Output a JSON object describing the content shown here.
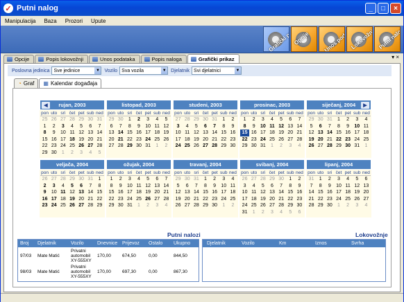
{
  "window": {
    "title": "Putni nalog",
    "minimize": "_",
    "maximize": "□",
    "close": "×"
  },
  "menu": [
    "Manipulacija",
    "Baza",
    "Prozori",
    "Upute"
  ],
  "toolbar": [
    "Grafički prikaz",
    "Opcije",
    "Unos podataka",
    "Lokovožnje",
    "Putni nalog"
  ],
  "tabs": [
    "Opcije",
    "Popis lokovožnji",
    "Unos podataka",
    "Popis naloga",
    "Grafički prikaz"
  ],
  "tab_close": "▾ ×",
  "filters": {
    "jedinica_label": "Poslovna jedinica",
    "jedinica": "Sve jedinice",
    "vozilo_label": "Vozilo",
    "vozilo": "Sva vozila",
    "djelatnik_label": "Djelatnik",
    "djelatnik": "Svi djelatnici",
    "arrow": "▼"
  },
  "subtabs": [
    "Graf",
    "Kalendar događaja"
  ],
  "calendar": {
    "dow": [
      "pon",
      "uto",
      "sri",
      "čet",
      "pet",
      "sub",
      "ned"
    ],
    "nav_prev": "◀",
    "nav_next": "▶",
    "months": [
      {
        "name": "rujan, 2003",
        "days": [
          "25o",
          "26o",
          "27o",
          "28o",
          "29o",
          "30o",
          "31o",
          "1",
          "2",
          "3b",
          "4",
          "5",
          "6",
          "7",
          "8b",
          "9",
          "10",
          "11",
          "12",
          "13",
          "14",
          "15",
          "16",
          "17",
          "18b",
          "19",
          "20",
          "21",
          "22",
          "23",
          "24",
          "25",
          "26b",
          "27b",
          "28",
          "29",
          "30",
          "1o",
          "2o",
          "3o",
          "4o",
          "5o"
        ]
      },
      {
        "name": "listopad, 2003",
        "days": [
          "29o",
          "30o",
          "1",
          "2b",
          "3",
          "4",
          "5",
          "6",
          "7",
          "8",
          "9",
          "10",
          "11",
          "12",
          "13",
          "14b",
          "15",
          "16",
          "17",
          "18",
          "19",
          "20",
          "21b",
          "22",
          "23",
          "24b",
          "25",
          "26",
          "27",
          "28",
          "29b",
          "30",
          "31",
          "1o",
          "2o"
        ]
      },
      {
        "name": "studeni, 2003",
        "days": [
          "27o",
          "28o",
          "29o",
          "30o",
          "31o",
          "1",
          "2",
          "3b",
          "4",
          "5",
          "6b",
          "7b",
          "8",
          "9",
          "10",
          "11",
          "12",
          "13",
          "14",
          "15",
          "16",
          "17",
          "18",
          "19",
          "20",
          "21",
          "22",
          "23",
          "24b",
          "25b",
          "26",
          "27b",
          "28b",
          "29",
          "30"
        ]
      },
      {
        "name": "prosinac, 2003",
        "days": [
          "1",
          "2",
          "3",
          "4",
          "5",
          "6",
          "7",
          "8b",
          "9",
          "10b",
          "11b",
          "12b",
          "13",
          "14",
          "15t",
          "16",
          "17",
          "18",
          "19",
          "20",
          "21",
          "22b",
          "23",
          "24b",
          "25",
          "26",
          "27",
          "28",
          "29",
          "30",
          "31",
          "1o",
          "2o",
          "3o",
          "4o"
        ]
      },
      {
        "name": "siječanj, 2004",
        "days": [
          "29o",
          "30o",
          "31o",
          "1",
          "2",
          "3",
          "4",
          "5",
          "6b",
          "7",
          "8",
          "9",
          "10b",
          "11",
          "12",
          "13b",
          "14b",
          "15",
          "16",
          "17",
          "18",
          "19b",
          "20b",
          "21",
          "22b",
          "23b",
          "24",
          "25",
          "26b",
          "27",
          "28b",
          "29",
          "30b",
          "31",
          "1o"
        ]
      },
      {
        "name": "veljača, 2004",
        "days": [
          "26o",
          "27o",
          "28o",
          "29o",
          "30o",
          "31o",
          "1",
          "2b",
          "3b",
          "4",
          "5b",
          "6b",
          "7",
          "8",
          "9b",
          "10",
          "11b",
          "12",
          "13b",
          "14",
          "15",
          "16b",
          "17b",
          "18",
          "19b",
          "20",
          "21",
          "22",
          "23b",
          "24b",
          "25",
          "26b",
          "27b",
          "28",
          "29"
        ]
      },
      {
        "name": "ožujak, 2004",
        "days": [
          "1",
          "2",
          "3",
          "4",
          "5",
          "6",
          "7",
          "8",
          "9",
          "10",
          "11",
          "12",
          "13",
          "14",
          "15",
          "16",
          "17",
          "18",
          "19",
          "20",
          "21",
          "22",
          "23",
          "24",
          "25",
          "26b",
          "27",
          "28",
          "29",
          "30",
          "31",
          "1o",
          "2o",
          "3o",
          "4o"
        ]
      },
      {
        "name": "travanj, 2004",
        "days": [
          "29o",
          "30o",
          "31o",
          "1",
          "2",
          "3",
          "4",
          "5",
          "6",
          "7",
          "8",
          "9",
          "10",
          "11",
          "12",
          "13",
          "14",
          "15",
          "16",
          "17",
          "18",
          "19",
          "20",
          "21",
          "22",
          "23",
          "24",
          "25",
          "26",
          "27",
          "28",
          "29",
          "30",
          "1o",
          "2o"
        ]
      },
      {
        "name": "svibanj, 2004",
        "days": [
          "26o",
          "27o",
          "28o",
          "29o",
          "30o",
          "1",
          "2",
          "3",
          "4",
          "5",
          "6",
          "7",
          "8",
          "9",
          "10",
          "11",
          "12",
          "13",
          "14",
          "15",
          "16",
          "17",
          "18",
          "19",
          "20",
          "21",
          "22",
          "23",
          "24",
          "25",
          "26",
          "27",
          "28",
          "29",
          "30",
          "31",
          "1o",
          "2o",
          "3o",
          "4o",
          "5o",
          "6o"
        ]
      },
      {
        "name": "lipanj, 2004",
        "days": [
          "31o",
          "1",
          "2",
          "3",
          "4",
          "5",
          "6",
          "7",
          "8",
          "9",
          "10",
          "11",
          "12",
          "13",
          "14",
          "15",
          "16",
          "17",
          "18",
          "19",
          "20",
          "21",
          "22",
          "23",
          "24",
          "25",
          "26",
          "27",
          "28",
          "29",
          "30",
          "1o",
          "2o",
          "3o",
          "4o"
        ]
      }
    ]
  },
  "putni_nalozi": {
    "title": "Putni nalozi",
    "columns": [
      "Broj",
      "Djelatnik",
      "Vozilo",
      "Dnevnice",
      "Prijevoz",
      "Ostalo",
      "Ukupno"
    ],
    "rows": [
      {
        "broj": "97/03",
        "djelatnik": "Mate Matić",
        "vozilo": [
          "Privatni",
          "automobil",
          "XY-555XY"
        ],
        "dnevnice": "170,00",
        "prijevoz": "674,50",
        "ostalo": "0,00",
        "ukupno": "844,50"
      },
      {
        "broj": "98/03",
        "djelatnik": "Mate Matić",
        "vozilo": [
          "Privatni",
          "automobil",
          "XY-555XY"
        ],
        "dnevnice": "170,00",
        "prijevoz": "697,30",
        "ostalo": "0,00",
        "ukupno": "867,30"
      }
    ]
  },
  "lokovoznje": {
    "title": "Lokovožnje",
    "columns": [
      "Djelatnik",
      "Vozilo",
      "Km",
      "Iznos",
      "Svrha"
    ]
  }
}
